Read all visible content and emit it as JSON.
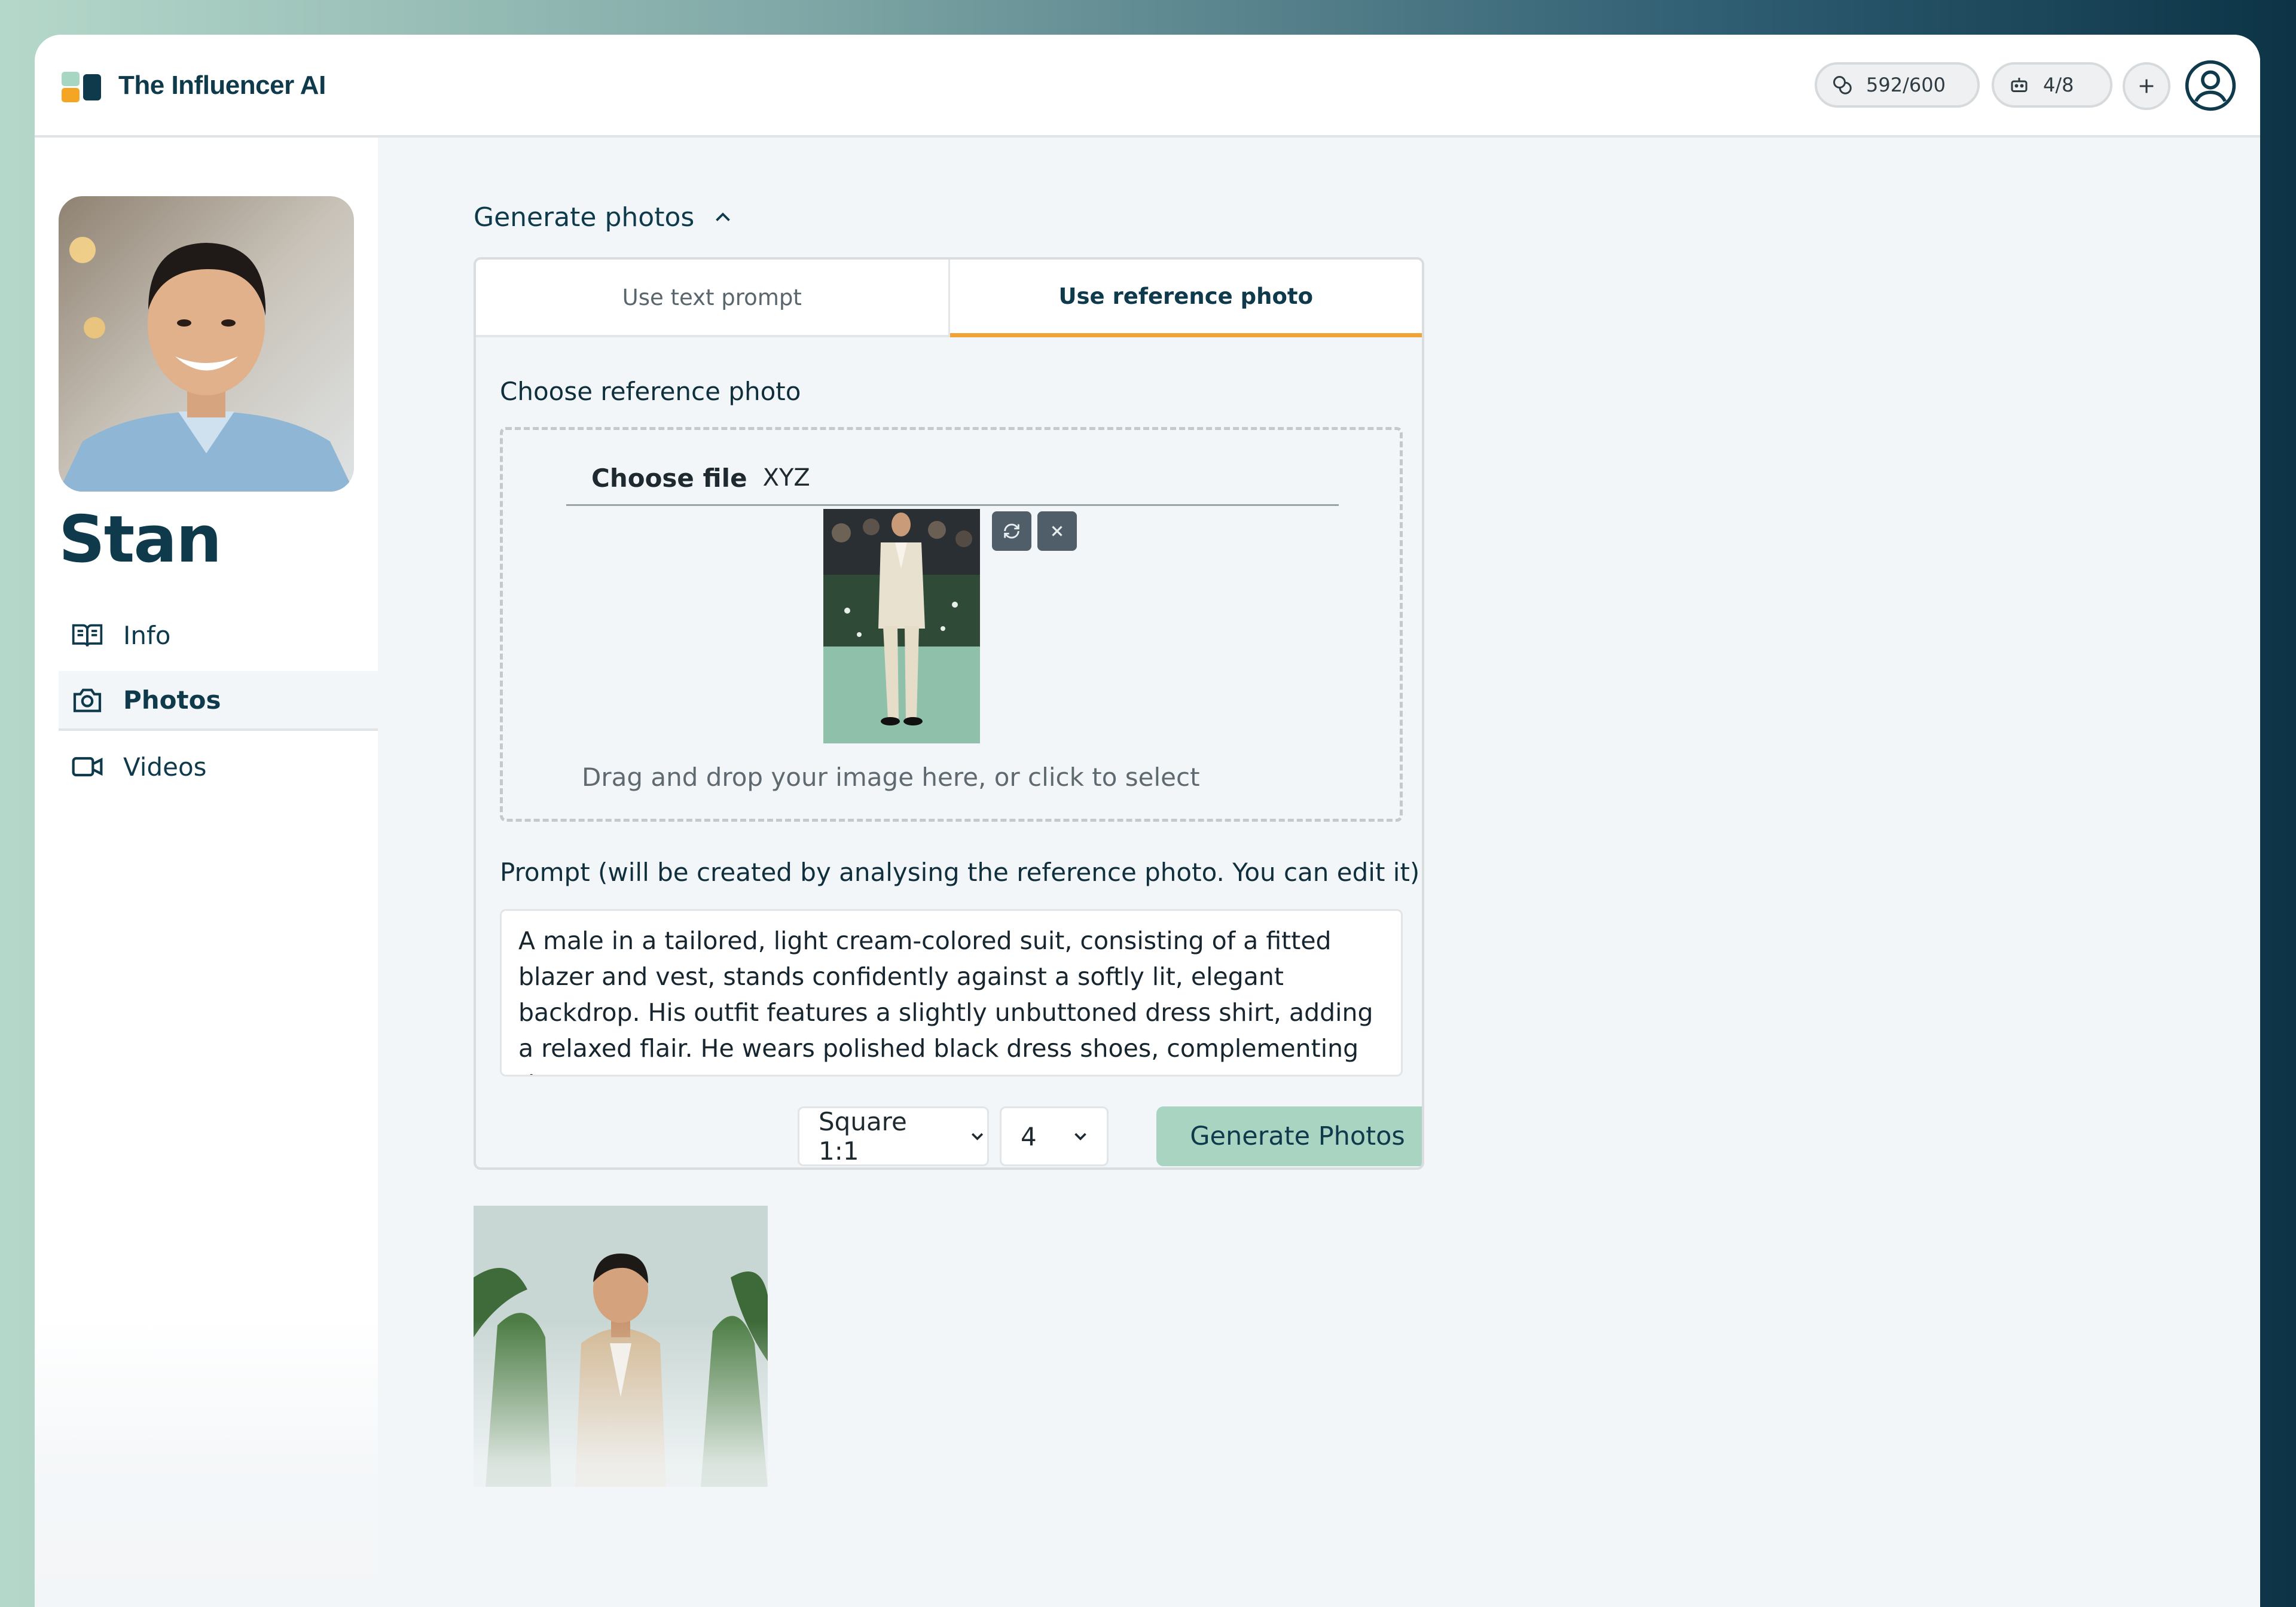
{
  "app": {
    "title": "The Influencer AI"
  },
  "header": {
    "credits_value": "592/600",
    "bots_value": "4/8",
    "credits_icon": "coins-icon",
    "bots_icon": "robot-icon",
    "add_icon": "plus-icon",
    "user_icon": "user-circle-icon"
  },
  "profile": {
    "name": "Stan"
  },
  "sidebar": {
    "items": [
      {
        "label": "Info",
        "icon": "book-open-icon",
        "active": false
      },
      {
        "label": "Photos",
        "icon": "camera-icon",
        "active": true
      },
      {
        "label": "Videos",
        "icon": "video-camera-icon",
        "active": false
      }
    ]
  },
  "main": {
    "section_title": "Generate photos",
    "tabs": [
      {
        "label": "Use text prompt",
        "active": false
      },
      {
        "label": "Use reference photo",
        "active": true
      }
    ],
    "reference": {
      "label": "Choose reference photo",
      "choose_file_label": "Choose file",
      "file_name": "XYZ",
      "drop_hint": "Drag and drop your image here, or click to select"
    },
    "prompt": {
      "label": "Prompt (will be created by analysing the reference photo. You can edit it)",
      "value": "A male in a tailored, light cream-colored suit, consisting of a fitted blazer and vest, stands confidently against a softly lit, elegant backdrop. His outfit features a slightly unbuttoned dress shirt, adding a relaxed flair. He wears polished black dress shoes, complementing the..."
    },
    "aspect_select": "Square 1:1",
    "count_select": "4",
    "generate_button": "Generate Photos"
  },
  "colors": {
    "brand_dark": "#0e3a4c",
    "accent_orange": "#f0a437",
    "button_green": "#a9d4c2"
  }
}
